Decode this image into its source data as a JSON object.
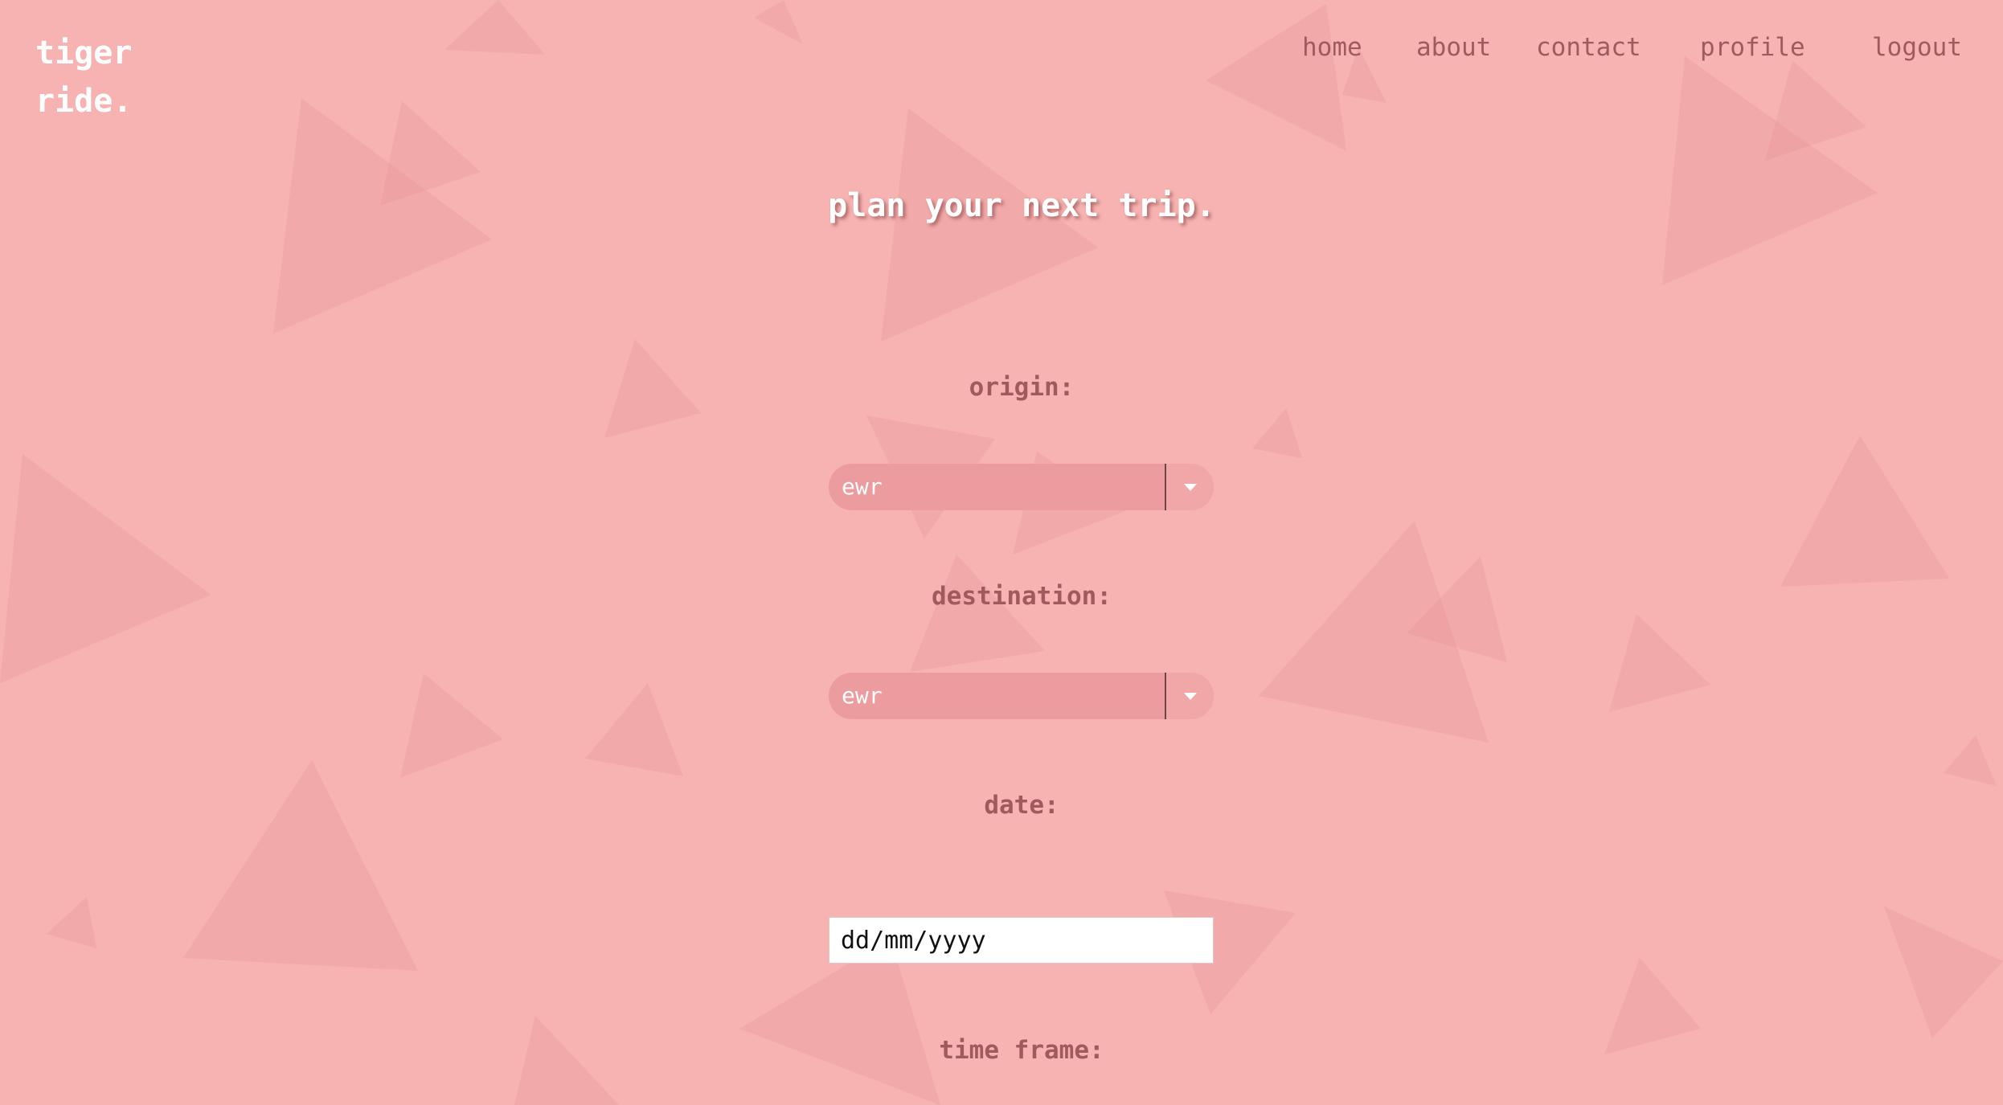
{
  "brand": {
    "line1": "tiger",
    "line2": "ride."
  },
  "nav": {
    "home": "home",
    "about": "about",
    "contact": "contact",
    "profile": "profile",
    "logout": "logout"
  },
  "page": {
    "title": "plan your next trip."
  },
  "form": {
    "origin": {
      "label": "origin:",
      "value": "ewr"
    },
    "destination": {
      "label": "destination:",
      "value": "ewr"
    },
    "date": {
      "label": "date:",
      "placeholder": "dd/mm/yyyy"
    },
    "time_frame": {
      "label": "time frame:"
    }
  },
  "colors": {
    "background": "#f6b3b1",
    "triangles": "#ea9698",
    "accent_text": "#a0595c",
    "select_fill": "#ec9c9e",
    "white": "#ffffff"
  },
  "icons": {
    "select_arrow": "chevron-down-icon"
  }
}
